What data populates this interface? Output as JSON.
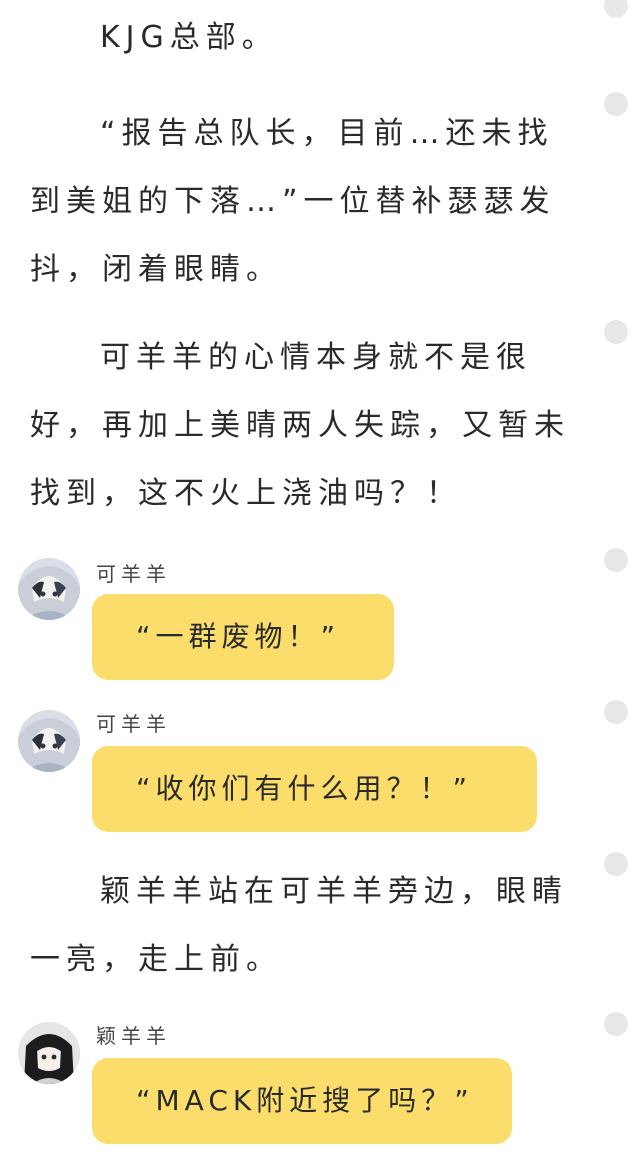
{
  "paragraphs": [
    "KJG总部。",
    "“报告总队长，目前…还未找到美姐的下落…”一位替补瑟瑟发抖，闭着眼睛。",
    "可羊羊的心情本身就不是很好，再加上美晴两人失踪，又暂未找到，这不火上浇油吗？！",
    "颖羊羊站在可羊羊旁边，眼睛一亮，走上前。"
  ],
  "messages": [
    {
      "sender": "可羊羊",
      "text": "“一群废物！”",
      "avatar": "avatar-kyy"
    },
    {
      "sender": "可羊羊",
      "text": "“收你们有什么用？！”",
      "avatar": "avatar-kyy"
    },
    {
      "sender": "颖羊羊",
      "text": "“MACK附近搜了吗？”",
      "avatar": "avatar-yyy"
    }
  ],
  "colors": {
    "bubble": "#fbdd6c",
    "text": "#2a2a2a",
    "side_dot": "#e8e8e8"
  }
}
